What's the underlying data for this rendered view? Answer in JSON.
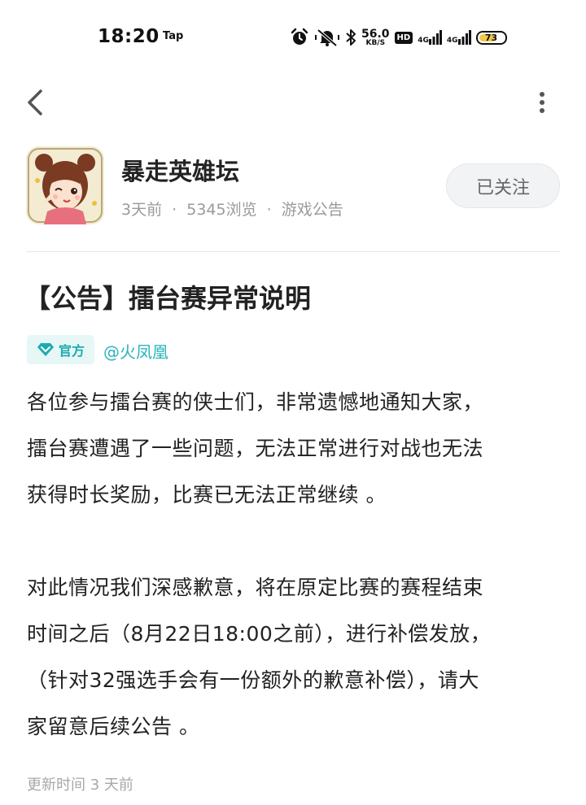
{
  "status_bar": {
    "time": "18:20",
    "tap_label": "Tap",
    "net_speed_value": "56.0",
    "net_speed_unit": "KB/S",
    "hd_badge": "HD",
    "signal1": "4G",
    "signal2": "4G",
    "battery_level": "73",
    "battery_color": "#f2c84b"
  },
  "nav": {
    "back_icon": "chevron-left-icon",
    "more_icon": "more-vertical-icon"
  },
  "forum": {
    "name": "暴走英雄坛",
    "time_ago": "3天前",
    "views": "5345浏览",
    "category": "游戏公告",
    "separator": "·",
    "follow_label": "已关注"
  },
  "post": {
    "title": "【公告】擂台赛异常说明",
    "official_label": "官方",
    "author": "@火凤凰",
    "paragraphs": [
      [
        "各位参与擂台赛的侠士们，非常遗憾地通知大家，",
        "擂台赛遭遇了一些问题，无法正常进行对战也无法",
        "获得时长奖励，比赛已无法正常继续 。"
      ],
      [
        "对此情况我们深感歉意，将在原定比赛的赛程结束",
        "时间之后（8月22日18:00之前），进行补偿发放，",
        "（针对32强选手会有一份额外的歉意补偿），请大",
        "家留意后续公告 。"
      ]
    ],
    "update_time": "更新时间 3 天前"
  },
  "colors": {
    "accent": "#2ab3bb",
    "badge_bg": "#e6f7f6",
    "meta_gray": "#9a9a9a"
  }
}
